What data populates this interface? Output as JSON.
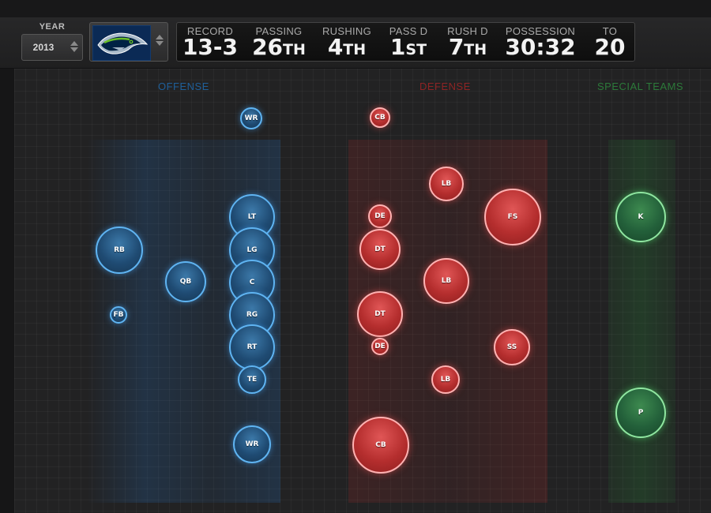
{
  "selector": {
    "year_label": "YEAR",
    "year_value": "2013",
    "team_logo_icon": "seahawks-logo-icon"
  },
  "stats": [
    {
      "label": "RECORD",
      "value": "13-3",
      "suffix": ""
    },
    {
      "label": "PASSING",
      "value": "26",
      "suffix": "TH"
    },
    {
      "label": "RUSHING",
      "value": "4",
      "suffix": "TH"
    },
    {
      "label": "PASS D",
      "value": "1",
      "suffix": "ST"
    },
    {
      "label": "RUSH D",
      "value": "7",
      "suffix": "TH"
    },
    {
      "label": "POSSESSION",
      "value": "30:32",
      "suffix": ""
    },
    {
      "label": "TO",
      "value": "20",
      "suffix": ""
    }
  ],
  "sections": {
    "offense": "OFFENSE",
    "defense": "DEFENSE",
    "special_teams": "SPECIAL TEAMS"
  },
  "colors": {
    "offense": "#3a8fd8",
    "defense": "#d43a3a",
    "special_teams": "#3fae55"
  },
  "players": {
    "offense": [
      "WR",
      "LT",
      "RB",
      "LG",
      "QB",
      "C",
      "FB",
      "RG",
      "RT",
      "TE",
      "WR"
    ],
    "defense": [
      "CB",
      "LB",
      "DE",
      "FS",
      "DT",
      "LB",
      "DT",
      "DE",
      "SS",
      "LB",
      "CB"
    ],
    "special_teams": [
      "K",
      "P"
    ]
  }
}
